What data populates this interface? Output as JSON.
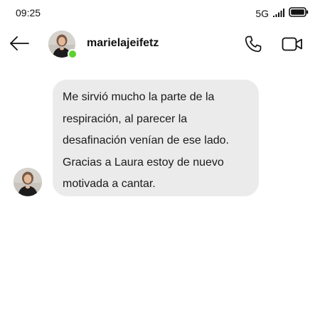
{
  "status_bar": {
    "time": "09:25",
    "network": "5G",
    "signal_icon": "signal-bars-icon",
    "battery_icon": "battery-icon"
  },
  "header": {
    "back_icon": "arrow-left-icon",
    "username": "marielajeifetz",
    "online": true,
    "online_color": "#5cd12f",
    "call_icon": "phone-icon",
    "video_icon": "video-camera-icon"
  },
  "conversation": {
    "messages": [
      {
        "sender": "marielajeifetz",
        "text": "Me sirvió mucho la parte de la\nrespiración, al parecer la\ndesafinación venían de ese lado.\nGracias a Laura estoy de nuevo\nmotivada a cantar.",
        "bubble_color": "#ebebeb"
      }
    ]
  }
}
